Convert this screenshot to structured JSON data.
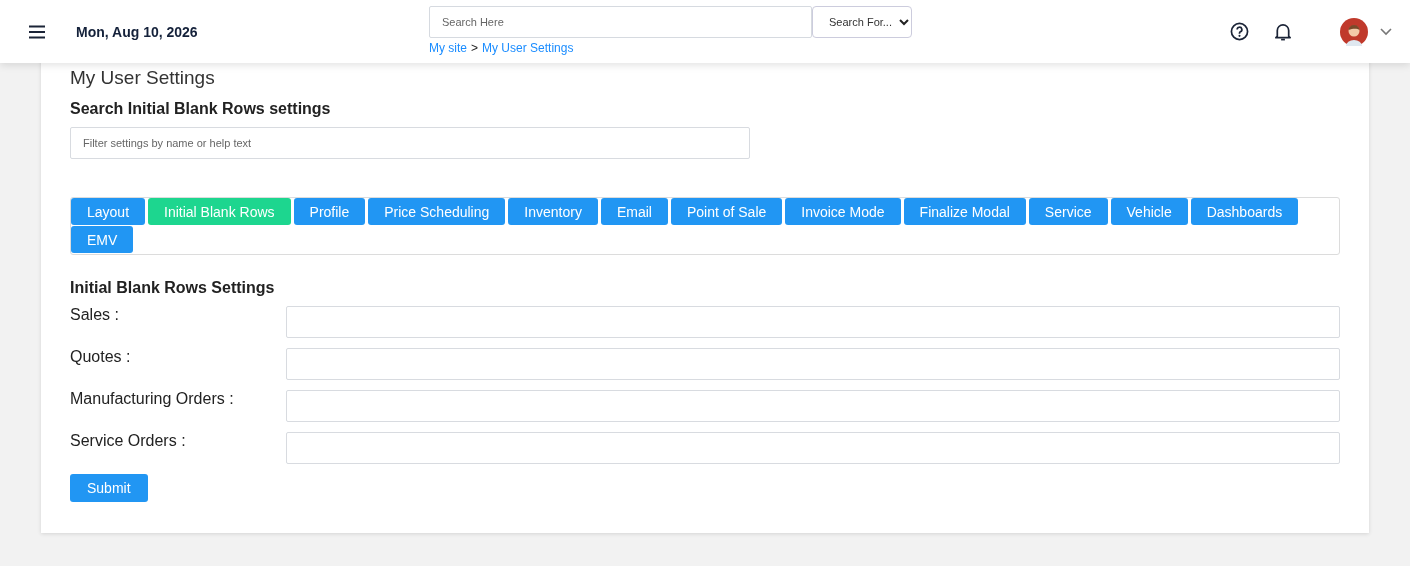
{
  "header": {
    "date": "Mon, Aug 10, 2026",
    "search": {
      "placeholder": "Search Here"
    },
    "search_for": "Search For...",
    "breadcrumb": [
      {
        "label": "My site"
      },
      {
        "label": "My User Settings"
      }
    ],
    "breadcrumb_separator": ">"
  },
  "page_title": "My User Settings",
  "search_section": {
    "title": "Search Initial Blank Rows settings",
    "placeholder": "Filter settings by name or help text"
  },
  "tabs": [
    {
      "label": "Layout",
      "selected": false
    },
    {
      "label": "Initial Blank Rows",
      "selected": true
    },
    {
      "label": "Profile",
      "selected": false
    },
    {
      "label": "Price Scheduling",
      "selected": false
    },
    {
      "label": "Inventory",
      "selected": false
    },
    {
      "label": "Email",
      "selected": false
    },
    {
      "label": "Point of Sale",
      "selected": false
    },
    {
      "label": "Invoice Mode",
      "selected": false
    },
    {
      "label": "Finalize Modal",
      "selected": false
    },
    {
      "label": "Service",
      "selected": false
    },
    {
      "label": "Vehicle",
      "selected": false
    },
    {
      "label": "Dashboards",
      "selected": false
    },
    {
      "label": "EMV",
      "selected": false
    }
  ],
  "settings": {
    "title": "Initial Blank Rows Settings",
    "fields": [
      {
        "label": "Sales :"
      },
      {
        "label": "Quotes :"
      },
      {
        "label": "Manufacturing Orders :"
      },
      {
        "label": "Service Orders :"
      }
    ],
    "submit": "Submit"
  }
}
